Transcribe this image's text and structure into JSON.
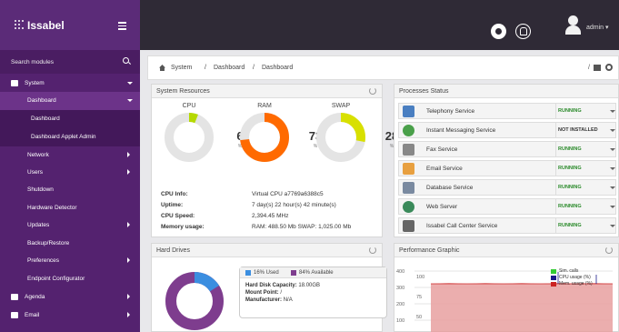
{
  "app": {
    "brand": "Issabel",
    "user": "admin"
  },
  "sidebar": {
    "search_placeholder": "Search modules",
    "items": [
      {
        "label": "System"
      },
      {
        "label": "Dashboard"
      },
      {
        "label": "Dashboard"
      },
      {
        "label": "Dashboard Applet Admin"
      },
      {
        "label": "Network"
      },
      {
        "label": "Users"
      },
      {
        "label": "Shutdown"
      },
      {
        "label": "Hardware Detector"
      },
      {
        "label": "Updates"
      },
      {
        "label": "Backup/Restore"
      },
      {
        "label": "Preferences"
      },
      {
        "label": "Endpoint Configurator"
      },
      {
        "label": "Agenda"
      },
      {
        "label": "Email"
      }
    ]
  },
  "breadcrumb": {
    "items": [
      "System",
      "Dashboard",
      "Dashboard"
    ],
    "sep": "/"
  },
  "system_resources": {
    "title": "System Resources",
    "gauges": [
      {
        "label": "CPU",
        "value": "6",
        "unit": "%",
        "fraction": 0.06,
        "color": "#b5d900"
      },
      {
        "label": "RAM",
        "value": "73",
        "unit": "%",
        "fraction": 0.73,
        "color": "#ff6a00"
      },
      {
        "label": "SWAP",
        "value": "28",
        "unit": "%",
        "fraction": 0.28,
        "color": "#d8e000"
      }
    ],
    "info": [
      {
        "key": "CPU Info:",
        "value": "Virtual CPU a7769a6388c5"
      },
      {
        "key": "Uptime:",
        "value": "7 day(s) 22 hour(s) 42 minute(s)"
      },
      {
        "key": "CPU Speed:",
        "value": "2,394.45 MHz"
      },
      {
        "key": "Memory usage:",
        "value": "RAM: 488.50 Mb SWAP: 1,025.00 Mb"
      }
    ]
  },
  "processes": {
    "title": "Processes Status",
    "rows": [
      {
        "name": "Telephony Service",
        "status": "RUNNING",
        "icon": "phone-icon",
        "color": "#4a7fc1"
      },
      {
        "name": "Instant Messaging Service",
        "status": "NOT INSTALLED",
        "icon": "chat-icon",
        "color": "#4aa04a"
      },
      {
        "name": "Fax Service",
        "status": "RUNNING",
        "icon": "fax-icon",
        "color": "#888888"
      },
      {
        "name": "Email Service",
        "status": "RUNNING",
        "icon": "email-icon",
        "color": "#e8a040"
      },
      {
        "name": "Database Service",
        "status": "RUNNING",
        "icon": "database-icon",
        "color": "#7a8aa0"
      },
      {
        "name": "Web Server",
        "status": "RUNNING",
        "icon": "globe-icon",
        "color": "#3a8a5a"
      },
      {
        "name": "Issabel Call Center Service",
        "status": "RUNNING",
        "icon": "headset-icon",
        "color": "#666666"
      }
    ]
  },
  "hard_drives": {
    "title": "Hard Drives",
    "used_label": "16% Used",
    "available_label": "84% Available",
    "used_color": "#3b8ee0",
    "available_color": "#7e3d8e",
    "value": "16",
    "unit": "%",
    "used_fraction": 0.16,
    "capacity_label": "Hard Disk Capacity:",
    "capacity_value": "18.00GB",
    "mount_label": "Mount Point:",
    "mount_value": "/",
    "manufacturer_label": "Manufacturer:",
    "manufacturer_value": "N/A"
  },
  "performance": {
    "title": "Performance Graphic",
    "y_ticks": [
      "400",
      "300",
      "200",
      "100"
    ],
    "y2_ticks": [
      "100",
      "75",
      "50"
    ],
    "legend": [
      {
        "label": "Sim. calls",
        "color": "#33cc33"
      },
      {
        "label": "CPU usage (%)",
        "color": "#1a1a8a"
      },
      {
        "label": "Mem. usage (%)",
        "color": "#cc2222"
      }
    ]
  }
}
